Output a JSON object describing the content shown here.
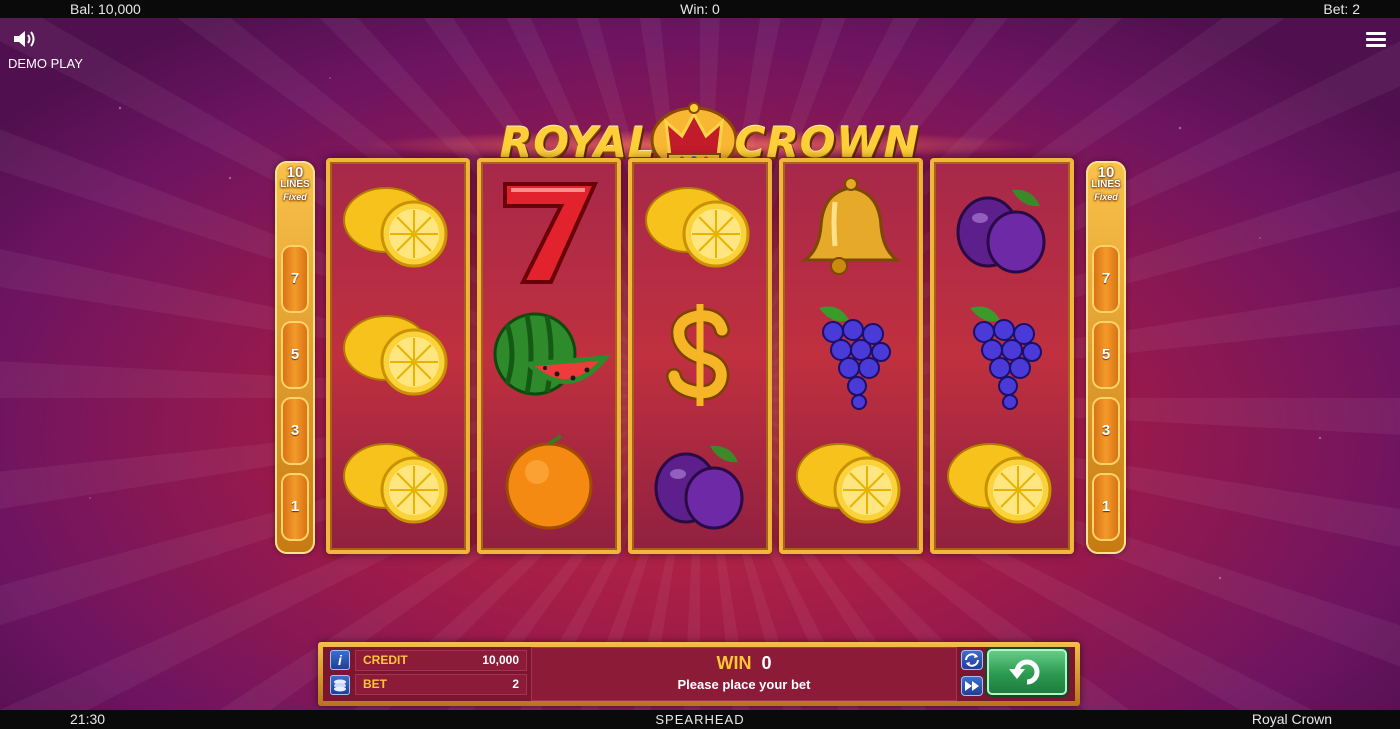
{
  "top_bar": {
    "balance": "Bal: 10,000",
    "win": "Win: 0",
    "bet": "Bet: 2"
  },
  "bottom_bar": {
    "time": "21:30",
    "provider": "SPEARHEAD",
    "game_name": "Royal Crown"
  },
  "header": {
    "mode": "DEMO PLAY",
    "sound_icon": "speaker-icon",
    "menu_icon": "hamburger-menu-icon"
  },
  "logo": {
    "word1": "ROYAL",
    "word2": "CROWN"
  },
  "lines_indicator": {
    "count": "10",
    "label": "LINES",
    "sub": "Fixed",
    "numbers": [
      "7",
      "5",
      "3",
      "1"
    ]
  },
  "reels": [
    [
      "lemon",
      "lemon",
      "lemon"
    ],
    [
      "seven",
      "watermelon",
      "orange"
    ],
    [
      "lemon",
      "dollar",
      "plum"
    ],
    [
      "bell",
      "grapes",
      "lemon"
    ],
    [
      "plum",
      "grapes",
      "lemon"
    ]
  ],
  "panel": {
    "credit_label": "CREDIT",
    "credit_value": "10,000",
    "bet_label": "BET",
    "bet_value": "2",
    "win_label": "WIN",
    "win_value": "0",
    "message": "Please place your bet",
    "info_icon": "info-icon",
    "coins_icon": "coins-icon",
    "autoplay_icon": "autoplay-icon",
    "turbo_icon": "fast-forward-icon",
    "spin_icon": "spin-icon",
    "info_glyph": "i"
  },
  "colors": {
    "accent_gold": "#ffc63a",
    "panel_bg": "#7a1630",
    "spin_green": "#2b9a4f"
  }
}
